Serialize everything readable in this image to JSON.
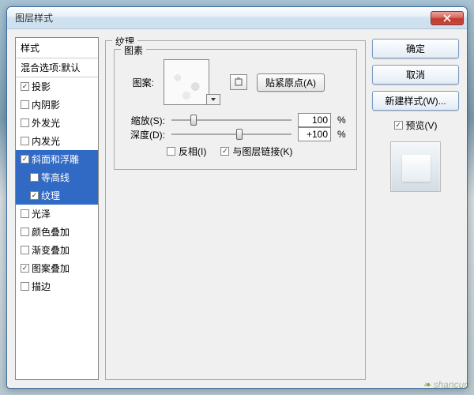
{
  "window": {
    "title": "图层样式"
  },
  "sidebar": {
    "header": "样式",
    "blend_default": "混合选项:默认",
    "items": [
      {
        "label": "投影",
        "checked": true
      },
      {
        "label": "内阴影",
        "checked": false
      },
      {
        "label": "外发光",
        "checked": false
      },
      {
        "label": "内发光",
        "checked": false
      },
      {
        "label": "斜面和浮雕",
        "checked": true,
        "selected_group": true
      },
      {
        "label": "等高线",
        "checked": false,
        "sub": true
      },
      {
        "label": "纹理",
        "checked": true,
        "sub": true,
        "selected": true
      },
      {
        "label": "光泽",
        "checked": false
      },
      {
        "label": "颜色叠加",
        "checked": false
      },
      {
        "label": "渐变叠加",
        "checked": false
      },
      {
        "label": "图案叠加",
        "checked": true
      },
      {
        "label": "描边",
        "checked": false
      }
    ]
  },
  "texture": {
    "title": "纹理",
    "elements_title": "图素",
    "pattern_label": "图案:",
    "snap_origin_btn": "贴紧原点(A)",
    "scale_label": "缩放(S):",
    "scale_value": "100",
    "scale_unit": "%",
    "depth_label": "深度(D):",
    "depth_value": "+100",
    "depth_unit": "%",
    "invert_label": "反相(I)",
    "invert_checked": false,
    "link_label": "与图层链接(K)",
    "link_checked": true
  },
  "buttons": {
    "ok": "确定",
    "cancel": "取消",
    "new_style": "新建样式(W)...",
    "preview": "预览(V)"
  },
  "watermark": "shancun"
}
